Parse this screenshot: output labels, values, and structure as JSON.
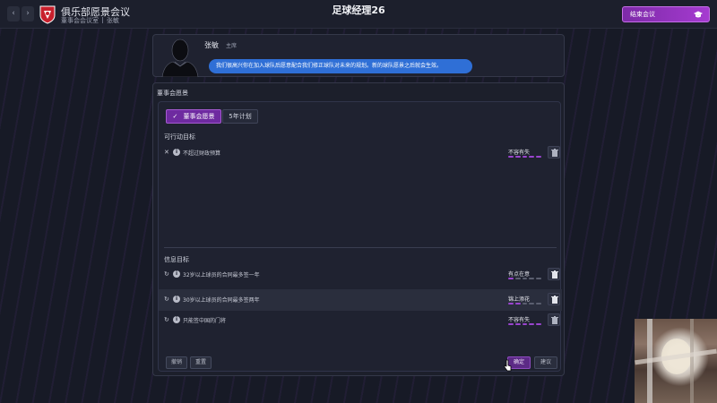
{
  "header": {
    "back": "‹",
    "forward": "›",
    "app_title": "俱乐部愿景会议",
    "breadcrumb_1": "董事会会议室",
    "breadcrumb_2": "张敏",
    "game_title": "足球经理26",
    "end_meeting": "结束会议"
  },
  "chairman": {
    "name": "张敏",
    "role": "主席",
    "speech": "我们很高兴你在加入球队后愿意配合我们修正球队对未来的规划。新的球队愿景之后就会生效。"
  },
  "panel": {
    "title": "董事会愿景",
    "tabs": [
      {
        "label": "董事会愿景",
        "check": "✓"
      },
      {
        "label": "5年计划"
      }
    ]
  },
  "actionable": {
    "title": "可行动目标",
    "items": [
      {
        "text": "不超过财政预算",
        "status": "不容有失",
        "level": 5
      }
    ]
  },
  "info": {
    "title": "信息目标",
    "items": [
      {
        "text": "32岁以上球员的合同最多签一年",
        "status": "有点在意",
        "level": 1
      },
      {
        "text": "30岁以上球员的合同最多签两年",
        "status": "锦上添花",
        "level": 2
      },
      {
        "text": "只能签中国的门将",
        "status": "不容有失",
        "level": 5
      }
    ]
  },
  "buttons": {
    "undo": "撤销",
    "reset": "重置",
    "confirm": "确定",
    "suggest": "建议"
  },
  "colors": {
    "accent": "#9a45cf",
    "speech": "#2f6fd6",
    "background": "#171a26"
  }
}
